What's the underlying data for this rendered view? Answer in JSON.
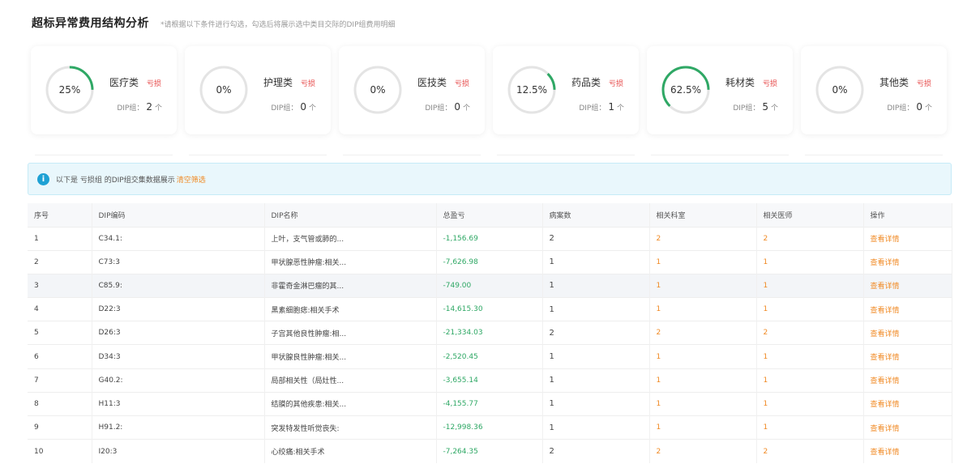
{
  "header": {
    "title": "超标异常费用结构分析",
    "hint": "*请根据以下条件进行勾选，勾选后将展示选中类目交际的DIP组费用明细"
  },
  "cards": [
    {
      "percent_label": "25%",
      "percent": 25,
      "name": "医疗类",
      "tag": "亏损",
      "dip_label": "DIP组：",
      "dip_count": "2",
      "unit": "个"
    },
    {
      "percent_label": "0%",
      "percent": 0,
      "name": "护理类",
      "tag": "亏损",
      "dip_label": "DIP组：",
      "dip_count": "0",
      "unit": "个"
    },
    {
      "percent_label": "0%",
      "percent": 0,
      "name": "医技类",
      "tag": "亏损",
      "dip_label": "DIP组：",
      "dip_count": "0",
      "unit": "个"
    },
    {
      "percent_label": "12.5%",
      "percent": 12.5,
      "name": "药品类",
      "tag": "亏损",
      "dip_label": "DIP组：",
      "dip_count": "1",
      "unit": "个"
    },
    {
      "percent_label": "62.5%",
      "percent": 62.5,
      "name": "耗材类",
      "tag": "亏损",
      "dip_label": "DIP组：",
      "dip_count": "5",
      "unit": "个"
    },
    {
      "percent_label": "0%",
      "percent": 0,
      "name": "其他类",
      "tag": "亏损",
      "dip_label": "DIP组：",
      "dip_count": "0",
      "unit": "个"
    }
  ],
  "colors": {
    "ring_track": "#e4e4e4",
    "ring_fill": "#2fa865",
    "loss": "#e64545",
    "link": "#f08a24",
    "info": "#1ea1d4"
  },
  "notice": {
    "icon": "info-icon",
    "message": "以下是 亏损组 的DIP组交集数据展示",
    "clear_label": "清空筛选"
  },
  "table": {
    "columns": [
      "序号",
      "DIP编码",
      "DIP名称",
      "总盈亏",
      "病案数",
      "相关科室",
      "相关医师",
      "操作"
    ],
    "rows": [
      {
        "index": "1",
        "code": "C34.1:",
        "name": "上叶，支气管或肺的...",
        "profit": "-1,156.69",
        "cases": "2",
        "depts": "2",
        "doctors": "2",
        "action": "查看详情"
      },
      {
        "index": "2",
        "code": "C73:3",
        "name": "甲状腺恶性肿瘤:相关...",
        "profit": "-7,626.98",
        "cases": "1",
        "depts": "1",
        "doctors": "1",
        "action": "查看详情"
      },
      {
        "index": "3",
        "code": "C85.9:",
        "name": "非霍奇金淋巴瘤的其...",
        "profit": "-749.00",
        "cases": "1",
        "depts": "1",
        "doctors": "1",
        "action": "查看详情"
      },
      {
        "index": "4",
        "code": "D22:3",
        "name": "黑素细胞痣:相关手术",
        "profit": "-14,615.30",
        "cases": "1",
        "depts": "1",
        "doctors": "1",
        "action": "查看详情"
      },
      {
        "index": "5",
        "code": "D26:3",
        "name": "子宫其他良性肿瘤:相...",
        "profit": "-21,334.03",
        "cases": "2",
        "depts": "2",
        "doctors": "2",
        "action": "查看详情"
      },
      {
        "index": "6",
        "code": "D34:3",
        "name": "甲状腺良性肿瘤:相关...",
        "profit": "-2,520.45",
        "cases": "1",
        "depts": "1",
        "doctors": "1",
        "action": "查看详情"
      },
      {
        "index": "7",
        "code": "G40.2:",
        "name": "局部相关性（局灶性...",
        "profit": "-3,655.14",
        "cases": "1",
        "depts": "1",
        "doctors": "1",
        "action": "查看详情"
      },
      {
        "index": "8",
        "code": "H11:3",
        "name": "结膜的其他疾患:相关...",
        "profit": "-4,155.77",
        "cases": "1",
        "depts": "1",
        "doctors": "1",
        "action": "查看详情"
      },
      {
        "index": "9",
        "code": "H91.2:",
        "name": "突发特发性听觉丧失:",
        "profit": "-12,998.36",
        "cases": "1",
        "depts": "1",
        "doctors": "1",
        "action": "查看详情"
      },
      {
        "index": "10",
        "code": "I20:3",
        "name": "心绞痛:相关手术",
        "profit": "-7,264.35",
        "cases": "2",
        "depts": "2",
        "doctors": "2",
        "action": "查看详情"
      }
    ]
  }
}
